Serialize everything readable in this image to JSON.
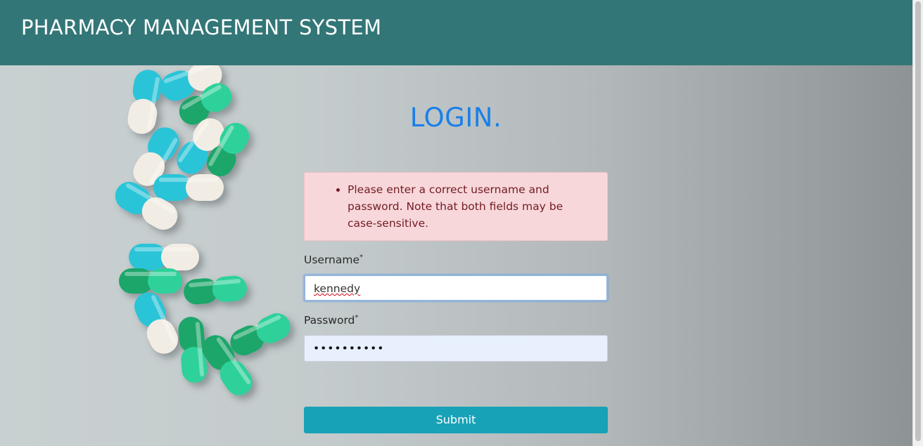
{
  "header": {
    "brand": "PHARMACY MANAGEMENT SYSTEM"
  },
  "login": {
    "title": "LOGIN.",
    "errors": [
      "Please enter a correct username and password. Note that both fields may be case-sensitive."
    ],
    "username": {
      "label": "Username",
      "required_mark": "*",
      "value": "kennedy"
    },
    "password": {
      "label": "Password",
      "required_mark": "*",
      "masked_value": "••••••••••"
    },
    "submit_label": "Submit"
  },
  "colors": {
    "navbar": "#337677",
    "title": "#1a7fe8",
    "alert_bg": "#f8d7da",
    "alert_text": "#721c24",
    "submit_bg": "#17a2b8"
  }
}
